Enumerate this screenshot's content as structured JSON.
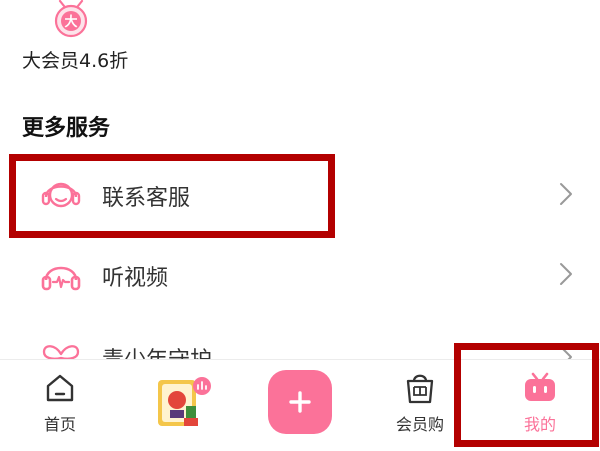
{
  "vip": {
    "label": "大会员4.6折",
    "badge_text": "大",
    "icon": "vip-bag-icon"
  },
  "more_services": {
    "title": "更多服务",
    "items": [
      {
        "label": "联系客服",
        "icon": "headset-icon"
      },
      {
        "label": "听视频",
        "icon": "headphones-wave-icon"
      },
      {
        "label": "青少年守护",
        "icon": "butterfly-icon"
      }
    ]
  },
  "tabbar": {
    "items": [
      {
        "label": "首页",
        "icon": "home-icon"
      },
      {
        "label": "",
        "icon": "mini-game-icon"
      },
      {
        "label": "",
        "icon": "plus-icon"
      },
      {
        "label": "会员购",
        "icon": "shopping-bag-icon"
      },
      {
        "label": "我的",
        "icon": "tv-face-icon"
      }
    ]
  },
  "colors": {
    "accent": "#fb7299",
    "annotation": "#b30000",
    "text": "#333333"
  }
}
